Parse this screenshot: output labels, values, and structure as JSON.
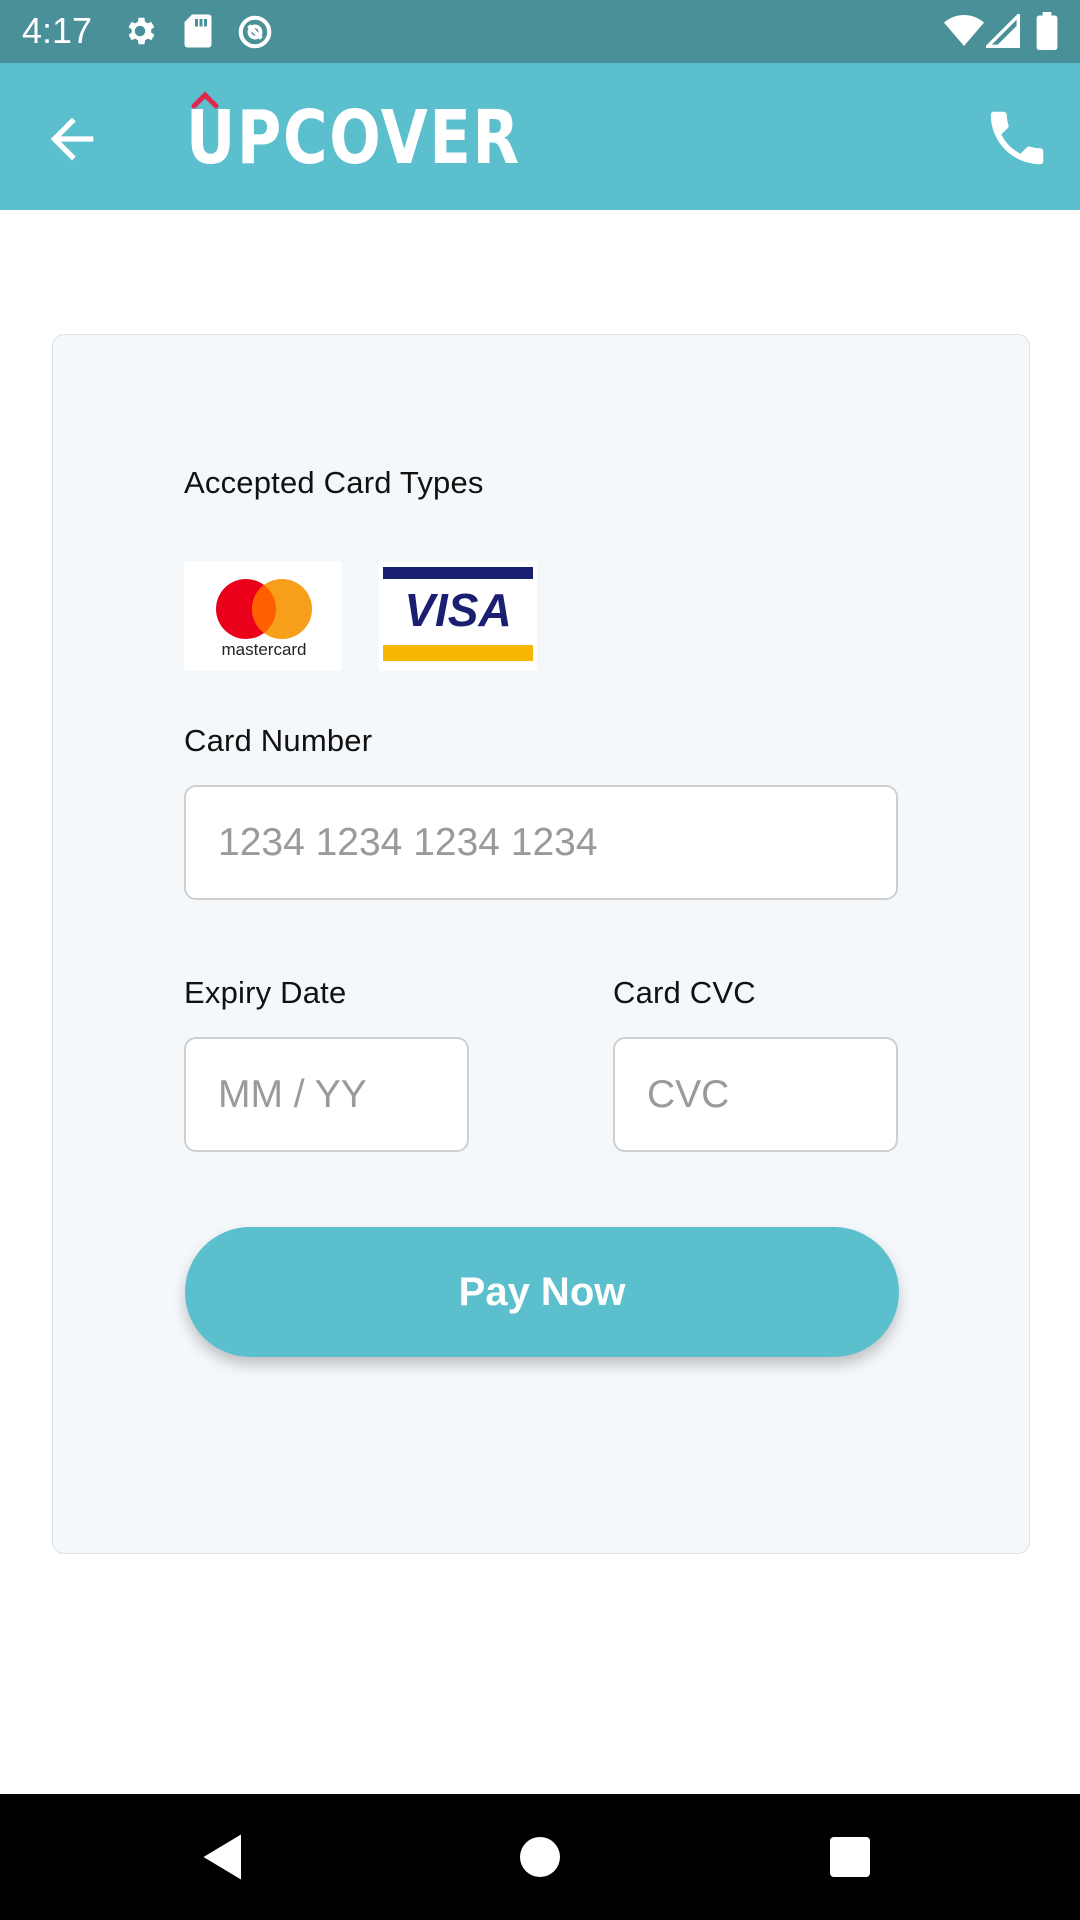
{
  "status_bar": {
    "time": "4:17",
    "icons": [
      "gear-icon",
      "sd-card-icon",
      "sync-icon",
      "wifi-icon",
      "signal-icon",
      "battery-icon"
    ]
  },
  "app_bar": {
    "logo_text": "UPCOVER",
    "logo_accent_color": "#e0284f",
    "background_color": "#5bbfcd",
    "back_icon": "arrow-left-icon",
    "call_icon": "phone-icon"
  },
  "payment_form": {
    "accepted_cards_label": "Accepted Card Types",
    "cards": [
      {
        "name": "mastercard",
        "text": "mastercard"
      },
      {
        "name": "visa",
        "text": "VISA"
      }
    ],
    "card_number": {
      "label": "Card Number",
      "value": "",
      "placeholder": "1234 1234 1234 1234"
    },
    "expiry": {
      "label": "Expiry Date",
      "value": "",
      "placeholder": "MM / YY"
    },
    "cvc": {
      "label": "Card CVC",
      "value": "",
      "placeholder": "CVC"
    },
    "pay_button_label": "Pay Now"
  },
  "nav_bar": {
    "icons": [
      "back-triangle-icon",
      "home-circle-icon",
      "recents-square-icon"
    ]
  }
}
